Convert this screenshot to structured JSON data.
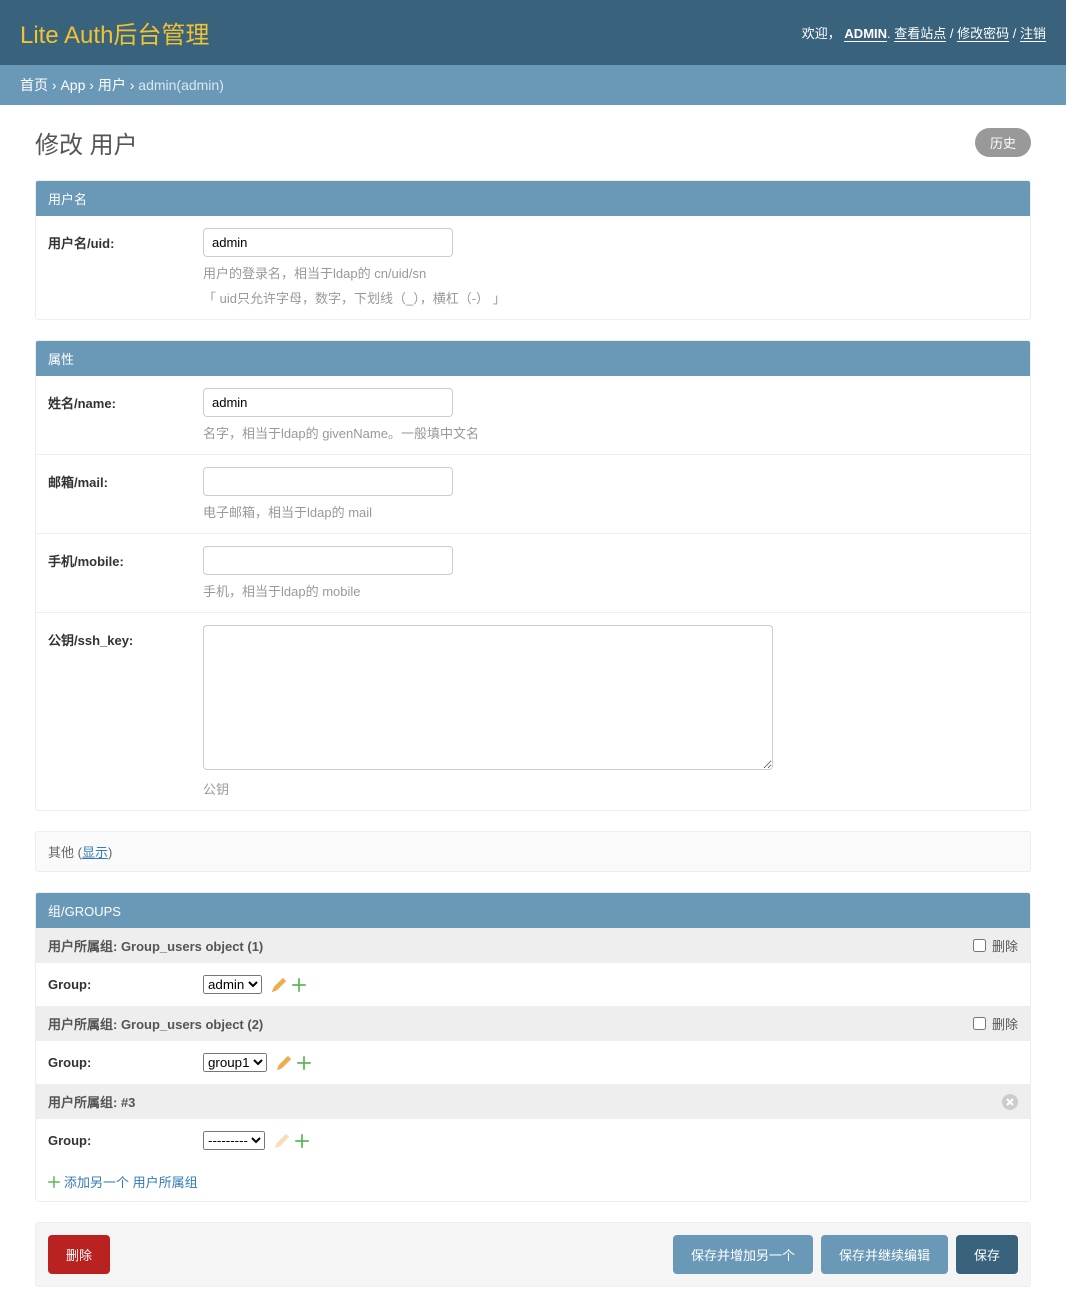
{
  "header": {
    "title": "Lite Auth后台管理",
    "welcome": "欢迎，",
    "admin_name": "ADMIN",
    "view_site": "查看站点",
    "change_password": "修改密码",
    "logout": "注销",
    "separator": " / "
  },
  "breadcrumbs": {
    "home": "首页",
    "app": "App",
    "users": "用户",
    "current": "admin(admin)",
    "sep": " › "
  },
  "page": {
    "title": "修改 用户",
    "history_btn": "历史"
  },
  "fieldsets": {
    "username": {
      "title": "用户名",
      "uid_label": "用户名/uid:",
      "uid_value": "admin",
      "uid_help1": "用户的登录名，相当于ldap的 cn/uid/sn",
      "uid_help2": "「 uid只允许字母，数字，下划线（_），横杠（-） 」"
    },
    "attrs": {
      "title": "属性",
      "name_label": "姓名/name:",
      "name_value": "admin",
      "name_help": "名字，相当于ldap的 givenName。一般填中文名",
      "mail_label": "邮箱/mail:",
      "mail_value": "",
      "mail_help": "电子邮箱，相当于ldap的 mail",
      "mobile_label": "手机/mobile:",
      "mobile_value": "",
      "mobile_help": "手机，相当于ldap的 mobile",
      "sshkey_label": "公钥/ssh_key:",
      "sshkey_value": "",
      "sshkey_help": "公钥"
    }
  },
  "collapse": {
    "prefix": "其他 (",
    "link": "显示",
    "suffix": ")"
  },
  "groups": {
    "title": "组/GROUPS",
    "delete_label": "删除",
    "group_label": "Group:",
    "rows": [
      {
        "header": "用户所属组: Group_users object (1)",
        "selected": "admin",
        "has_delete_checkbox": true
      },
      {
        "header": "用户所属组: Group_users object (2)",
        "selected": "group1",
        "has_delete_checkbox": true
      },
      {
        "header": "用户所属组: #3",
        "selected": "---------",
        "has_close_icon": true
      }
    ],
    "add_another": "添加另一个 用户所属组"
  },
  "submit": {
    "delete": "删除",
    "save_add_another": "保存并增加另一个",
    "save_continue": "保存并继续编辑",
    "save": "保存"
  }
}
